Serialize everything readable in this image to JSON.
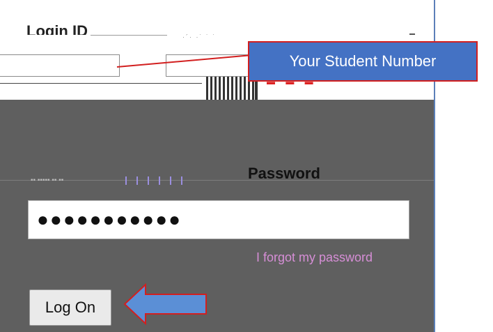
{
  "login": {
    "label": "Login ID",
    "id_left_fragment": "",
    "id_value": "",
    "callout": "Your Student Number"
  },
  "password": {
    "label": "Password",
    "masked_value": "●●●●●●●●●●●",
    "forgot_link": "I forgot my password"
  },
  "actions": {
    "logon_label": "Log On"
  },
  "colors": {
    "callout_bg": "#4472c4",
    "annotation_red": "#d21f1f",
    "arrow_fill": "#5b8fd6",
    "panel_bg": "#5f5f5f"
  },
  "icons": {
    "arrow": "left-arrow-icon"
  }
}
